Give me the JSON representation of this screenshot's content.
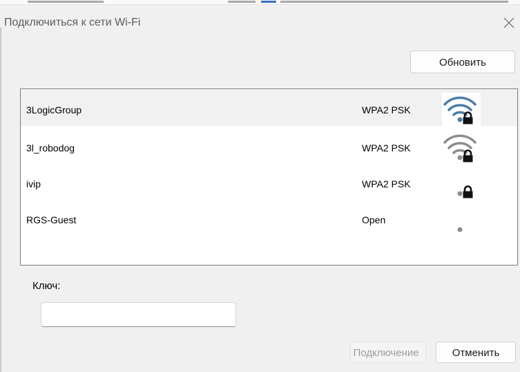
{
  "dialog": {
    "title": "Подключиться к сети Wi-Fi",
    "refresh_label": "Обновить",
    "key_label": "Ключ:",
    "key_value": "",
    "connect_label": "Подключение",
    "cancel_label": "Отменить"
  },
  "networks": [
    {
      "name": "3LogicGroup",
      "security": "WPA2 PSK",
      "signal_bars": 3,
      "locked": true,
      "selected": true,
      "bar_color": "#4d7da8"
    },
    {
      "name": "3l_robodog",
      "security": "WPA2 PSK",
      "signal_bars": 3,
      "locked": true,
      "selected": false,
      "bar_color": "#8c8c8c"
    },
    {
      "name": "ivip",
      "security": "WPA2 PSK",
      "signal_bars": 0,
      "locked": true,
      "selected": false,
      "bar_color": "#8c8c8c"
    },
    {
      "name": "RGS-Guest",
      "security": "Open",
      "signal_bars": 0,
      "locked": false,
      "selected": false,
      "bar_color": "#8c8c8c"
    }
  ],
  "icons": {
    "close": "close-icon",
    "signal": "wifi-signal-icon",
    "lock": "lock-icon"
  },
  "colors": {
    "background": "#f0f0f0",
    "list_background": "#ffffff",
    "selected_row": "#f1f1f1",
    "disabled_text": "#9c9c9c"
  }
}
